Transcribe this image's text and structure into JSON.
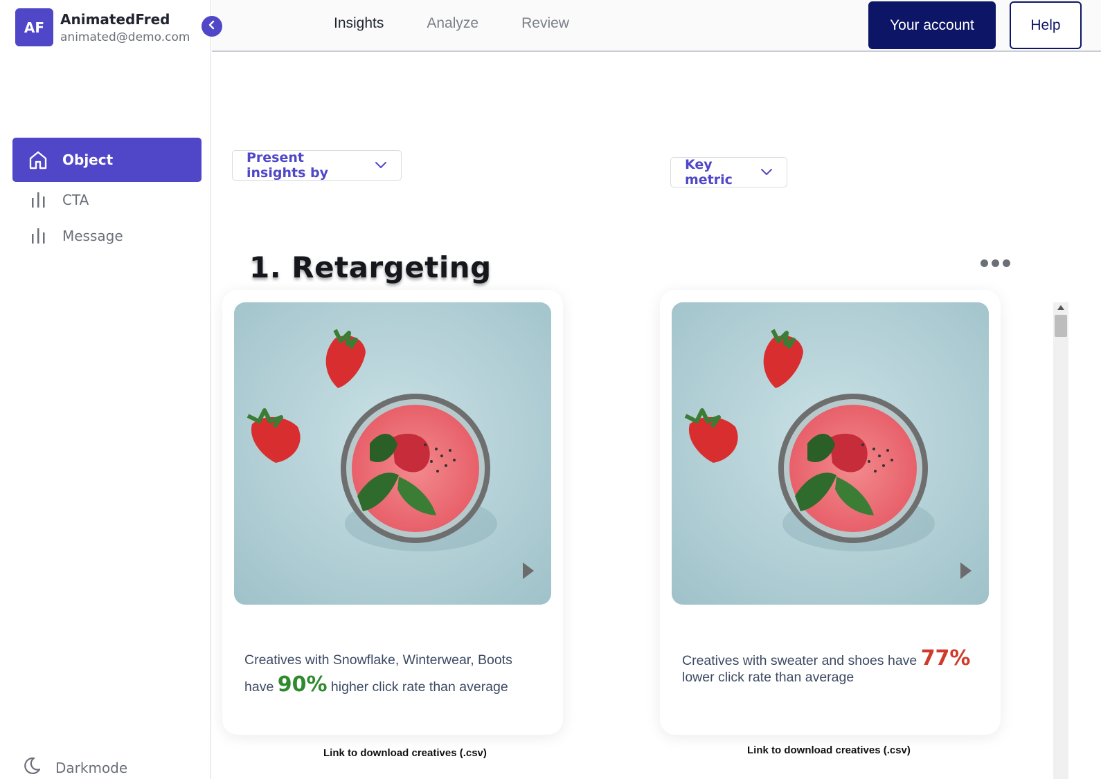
{
  "user": {
    "initials": "AF",
    "name": "AnimatedFred",
    "email": "animated@demo.com"
  },
  "sidebar": {
    "items": [
      {
        "label": "Object",
        "icon": "home-icon",
        "active": true
      },
      {
        "label": "CTA",
        "icon": "bar-chart-icon",
        "active": false
      },
      {
        "label": "Message",
        "icon": "bar-chart-icon",
        "active": false
      }
    ],
    "darkmode_label": "Darkmode"
  },
  "topbar": {
    "tabs": [
      {
        "label": "Insights",
        "active": true
      },
      {
        "label": "Analyze",
        "active": false
      },
      {
        "label": "Review",
        "active": false
      }
    ],
    "account_label": "Your account",
    "help_label": "Help"
  },
  "filters": {
    "present_by": "Present insights by",
    "key_metric": "Key metric"
  },
  "section": {
    "title": "1. Retargeting"
  },
  "cards": [
    {
      "text_before": "Creatives with Snowflake, Winterwear, Boots have ",
      "percent": "90%",
      "text_after": " higher click rate than average",
      "trend": "up",
      "download": "Link to download creatives (.csv)"
    },
    {
      "text_before": "Creatives with sweater and shoes have ",
      "percent": "77%",
      "text_after": " lower click rate than average",
      "trend": "down",
      "download": "Link to download creatives (.csv)"
    }
  ],
  "colors": {
    "primary": "#4f46c8",
    "account_button": "#0d1566",
    "positive": "#2f8a2f",
    "negative": "#d03a2a"
  }
}
